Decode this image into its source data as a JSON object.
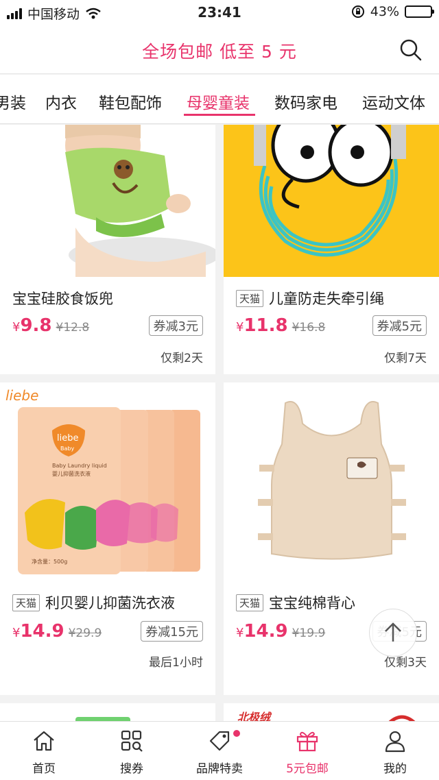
{
  "status": {
    "carrier": "中国移动",
    "time": "23:41",
    "battery": "43%",
    "battery_level": 0.43
  },
  "header": {
    "title": "全场包邮 低至 5 元"
  },
  "tabs": [
    {
      "label": "男装"
    },
    {
      "label": "内衣"
    },
    {
      "label": "鞋包配饰"
    },
    {
      "label": "母婴童装"
    },
    {
      "label": "数码家电"
    },
    {
      "label": "运动文体"
    }
  ],
  "products": [
    {
      "tag": "",
      "name": "宝宝硅胶食饭兜",
      "yen": "¥",
      "price": "9.8",
      "old_price": "¥12.8",
      "coupon": "券减3元",
      "remain": "仅剩2天"
    },
    {
      "tag": "天猫",
      "name": "儿童防走失牵引绳",
      "yen": "¥",
      "price": "11.8",
      "old_price": "¥16.8",
      "coupon": "券减5元",
      "remain": "仅剩7天"
    },
    {
      "tag": "天猫",
      "name": "利贝婴儿抑菌洗衣液",
      "yen": "¥",
      "price": "14.9",
      "old_price": "¥29.9",
      "coupon": "券减15元",
      "remain": "最后1小时"
    },
    {
      "tag": "天猫",
      "name": "宝宝纯棉背心",
      "yen": "¥",
      "price": "14.9",
      "old_price": "¥19.9",
      "coupon": "券减5元",
      "remain": "仅剩3天"
    }
  ],
  "product_images": {
    "bib_text": "",
    "liebe_brand": "liebe",
    "liebe_sub": "Baby",
    "liebe_pack_text": "Baby Laundry liquid",
    "liebe_pack_cn": "婴儿抑菌洗衣液",
    "liebe_net": "净含量：500g",
    "partial_brand": "北极绒"
  },
  "nav": [
    {
      "label": "首页",
      "icon": "home-icon"
    },
    {
      "label": "搜券",
      "icon": "search-coupon-icon"
    },
    {
      "label": "品牌特卖",
      "icon": "tag-icon"
    },
    {
      "label": "5元包邮",
      "icon": "gift-icon"
    },
    {
      "label": "我的",
      "icon": "user-icon"
    }
  ],
  "colors": {
    "accent": "#e8336b",
    "text": "#222222",
    "muted": "#888888"
  }
}
